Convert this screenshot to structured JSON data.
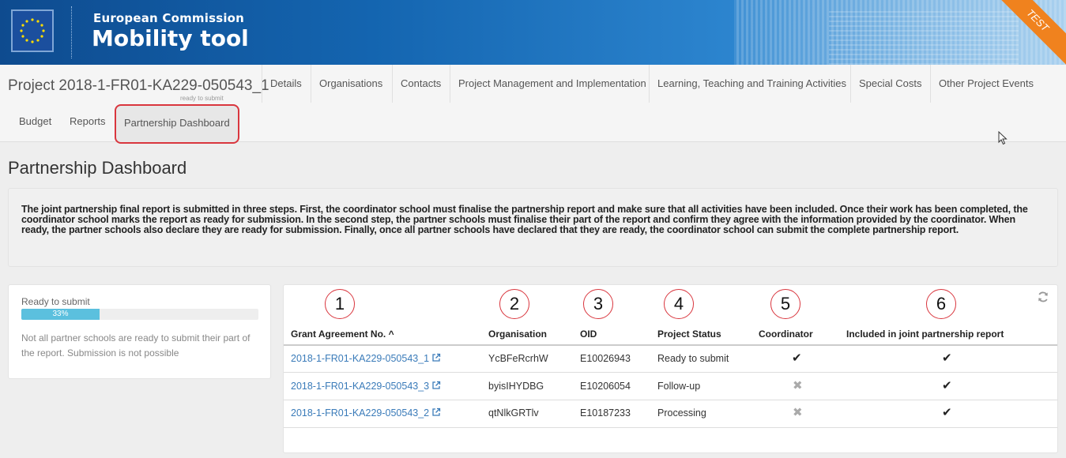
{
  "header": {
    "org_name": "European Commission",
    "app_title": "Mobility tool",
    "environment_badge": "TEST"
  },
  "nav": {
    "project_title": "Project 2018-1-FR01-KA229-050543_1",
    "project_status": "ready to submit",
    "tabs": [
      "Details",
      "Organisations",
      "Contacts",
      "Project Management and Implementation",
      "Learning, Teaching and Training Activities",
      "Special Costs",
      "Other Project Events"
    ],
    "tabs_row2": [
      "Budget",
      "Reports",
      "Partnership Dashboard"
    ],
    "active_tab": "Partnership Dashboard"
  },
  "page": {
    "title": "Partnership Dashboard",
    "info": "The joint partnership final report is submitted in three steps. First, the coordinator school must finalise the partnership report and make sure that all activities have been included. Once their work has been completed, the coordinator school marks the report as ready for submission. In the second step, the partner schools must finalise their part of the report and confirm they agree with the information provided by the coordinator. When ready, the partner schools also declare they are ready for submission. Finally, once all partner schools have declared that they are ready, the coordinator school can submit the complete partnership report."
  },
  "status_panel": {
    "label": "Ready to submit",
    "progress": 0.33,
    "progress_label": "33%",
    "message": "Not all partner schools are ready to submit their part of the report. Submission is not possible"
  },
  "annotations": [
    "1",
    "2",
    "3",
    "4",
    "5",
    "6"
  ],
  "table": {
    "columns": [
      "Grant Agreement No. ^",
      "Organisation",
      "OID",
      "Project Status",
      "Coordinator",
      "Included in joint partnership report"
    ],
    "rows": [
      {
        "grant": "2018-1-FR01-KA229-050543_1",
        "org": "YcBFeRcrhW",
        "oid": "E10026943",
        "status": "Ready to submit",
        "coordinator": "check",
        "included": "check"
      },
      {
        "grant": "2018-1-FR01-KA229-050543_3",
        "org": "byisIHYDBG",
        "oid": "E10206054",
        "status": "Follow-up",
        "coordinator": "cross",
        "included": "check"
      },
      {
        "grant": "2018-1-FR01-KA229-050543_2",
        "org": "qtNlkGRTlv",
        "oid": "E10187233",
        "status": "Processing",
        "coordinator": "cross",
        "included": "check"
      }
    ]
  },
  "colors": {
    "accent_link": "#3a7bb9",
    "highlight": "#d9363e",
    "progress": "#5bc0de",
    "banner": "#1465b0",
    "badge": "#f0821e"
  }
}
